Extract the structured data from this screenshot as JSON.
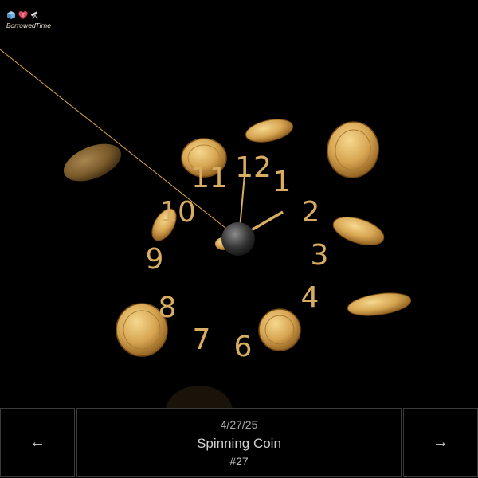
{
  "app": {
    "brand_name": "BorrowedTime",
    "logo_icons": [
      "cube-icon",
      "heart-icon",
      "telescope-icon"
    ]
  },
  "clock": {
    "numerals": [
      "12",
      "1",
      "2",
      "3",
      "4",
      "6",
      "7",
      "8",
      "9",
      "10",
      "11"
    ],
    "numeral_color": "#d8ad62",
    "hand_color": "#d8ad62",
    "second_hand_color": "#e0a64a"
  },
  "footer": {
    "prev_label": "←",
    "next_label": "→",
    "date": "4/27/25",
    "title": "Spinning Coin",
    "number": "#27"
  }
}
